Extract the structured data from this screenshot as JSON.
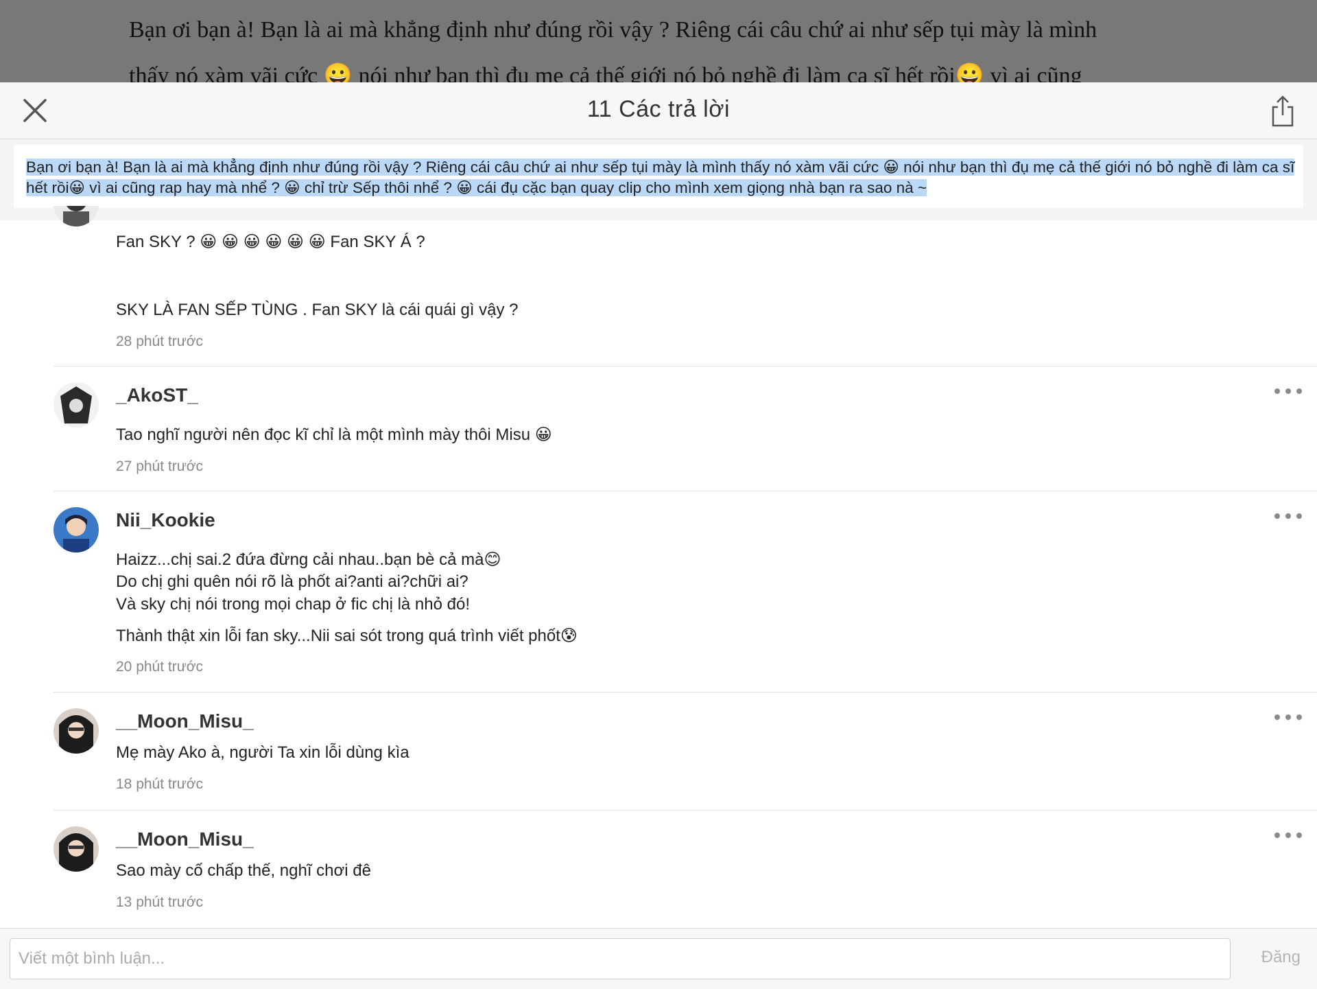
{
  "background_page": {
    "line1": "Bạn ơi bạn à! Bạn là ai mà khẳng định như đúng rồi vậy ? Riêng cái câu chứ ai như sếp tụi mày là mình",
    "line2": "thấy nó xàm vãi cức 😀 nói như bạn thì đụ mẹ cả thế giới nó bỏ nghề đi làm ca sĩ hết rồi😀 vì ai cũng"
  },
  "header": {
    "title": "11 Các trả lời"
  },
  "quote": {
    "line1": "Bạn ơi bạn à! Bạn là ai mà khẳng định như đúng rồi vậy ? Riêng cái câu chứ ai như sếp tụi mày là mình thấy nó xàm vãi cức 😀 nói như bạn thì đụ mẹ cả thế giới nó bỏ nghề đi làm ca sĩ",
    "line2": "hết rồi😀 vì ai cũng rap hay mà nhể ? 😀 chỉ trừ Sếp thôi nhể ? 😀 cái đụ cặc bạn quay clip cho mình xem giọng nhà bạn ra sao nà ~"
  },
  "comments": [
    {
      "username": "",
      "lines": [
        "Fan SKY ? 😀 😀 😀 😀 😀 😀  Fan SKY Á ?",
        "SKY LÀ FAN SẾP TÙNG . Fan SKY là cái quái gì vậy ?"
      ],
      "time": "28 phút trước"
    },
    {
      "username": "_AkoST_",
      "lines": [
        "Tao nghĩ người nên đọc kĩ chỉ là một mình mày thôi Misu 😀"
      ],
      "time": "27 phút trước"
    },
    {
      "username": "Nii_Kookie",
      "lines": [
        "Haizz...chị sai.2 đứa đừng cải nhau..bạn bè cả mà😊",
        "Do chị ghi quên nói rõ là phốt ai?anti ai?chữi ai?",
        "Và sky chị nói trong mọi chap ở fic chị là nhỏ đó!",
        "Thành thật xin lỗi fan sky...Nii sai sót trong quá trình viết phốt😰"
      ],
      "time": "20 phút trước"
    },
    {
      "username": "__Moon_Misu_",
      "lines": [
        "Mẹ mày Ako à, người Ta xin lỗi dùng kìa"
      ],
      "time": "18 phút trước"
    },
    {
      "username": "__Moon_Misu_",
      "lines": [
        "Sao mày cố chấp thế,  nghĩ chơi đê"
      ],
      "time": "13 phút trước"
    }
  ],
  "composer": {
    "placeholder": "Viết một bình luận...",
    "post_label": "Đăng"
  },
  "colors": {
    "selection_highlight": "#bcd8f7",
    "dim_overlay": "#787878",
    "post_disabled": "#b5b5b5"
  }
}
